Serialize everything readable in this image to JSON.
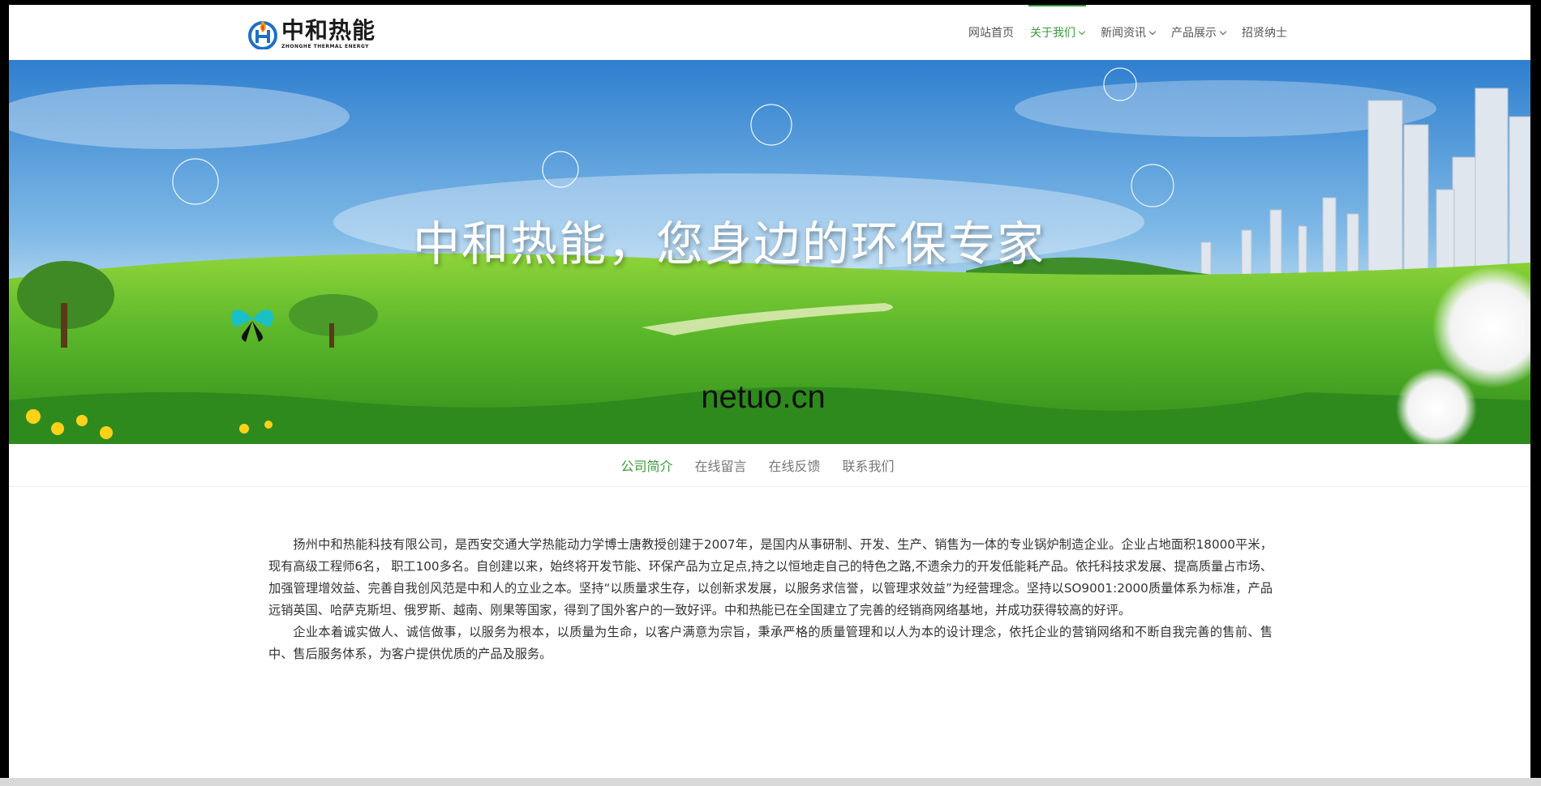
{
  "header": {
    "logo": {
      "name_cn": "中和热能",
      "name_en": "ZHONGHE THERMAL ENERGY"
    },
    "nav": [
      {
        "label": "网站首页",
        "has_dropdown": false,
        "active": false
      },
      {
        "label": "关于我们",
        "has_dropdown": true,
        "active": true
      },
      {
        "label": "新闻资讯",
        "has_dropdown": true,
        "active": false
      },
      {
        "label": "产品展示",
        "has_dropdown": true,
        "active": false
      },
      {
        "label": "招贤纳士",
        "has_dropdown": false,
        "active": false
      }
    ]
  },
  "banner": {
    "slogan": "中和热能，您身边的环保专家",
    "watermark": "netuo.cn"
  },
  "subnav": [
    {
      "label": "公司简介",
      "active": true
    },
    {
      "label": "在线留言",
      "active": false
    },
    {
      "label": "在线反馈",
      "active": false
    },
    {
      "label": "联系我们",
      "active": false
    }
  ],
  "content": {
    "paragraphs": [
      "扬州中和热能科技有限公司，是西安交通大学热能动力学博士唐教授创建于2007年，是国内从事研制、开发、生产、销售为一体的专业锅炉制造企业。企业占地面积18000平米，现有高级工程师6名， 职工100多名。自创建以来，始终将开发节能、环保产品为立足点,持之以恒地走自己的特色之路,不遗余力的开发低能耗产品。依托科技求发展、提高质量占市场、加强管理增效益、完善自我创风范是中和人的立业之本。坚持“以质量求生存，以创新求发展，以服务求信誉，以管理求效益”为经营理念。坚持以SO9001:2000质量体系为标准，产品远销英国、哈萨克斯坦、俄罗斯、越南、刚果等国家，得到了国外客户的一致好评。中和热能已在全国建立了完善的经销商网络基地，并成功获得较高的好评。",
      "企业本着诚实做人、诚信做事，以服务为根本，以质量为生命，以客户满意为宗旨，秉承严格的质量管理和以人为本的设计理念，依托企业的营销网络和不断自我完善的售前、售中、售后服务体系，为客户提供优质的产品及服务。"
    ]
  },
  "colors": {
    "accent": "#3a9a3a",
    "nav_text": "#555555",
    "body_text": "#333333"
  }
}
